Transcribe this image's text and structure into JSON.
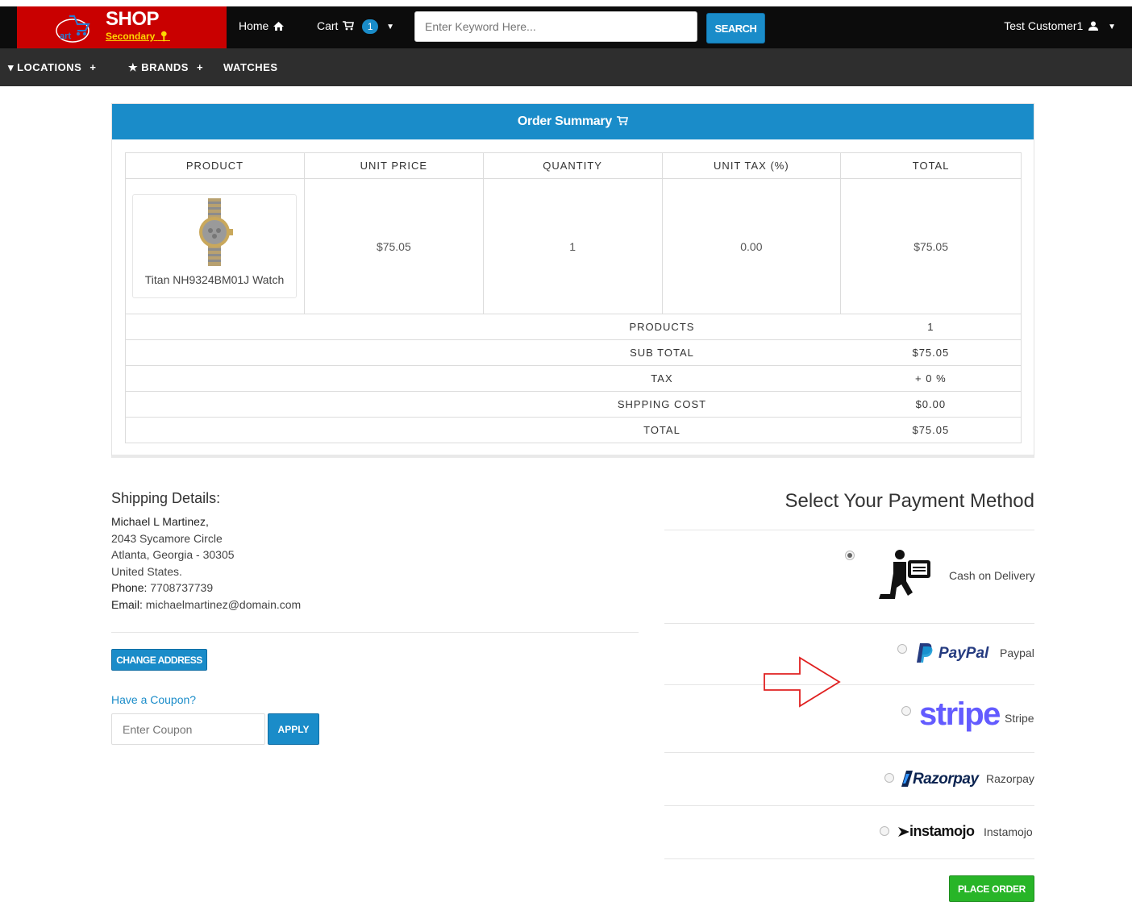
{
  "header": {
    "logo_title": "SHOP",
    "logo_subtitle": "Secondary",
    "home_label": "Home",
    "cart_label": "Cart",
    "cart_count": "1",
    "search_placeholder": "Enter Keyword Here...",
    "search_button": "SEARCH",
    "user_name": "Test Customer1"
  },
  "subnav": {
    "locations": "LOCATIONS",
    "brands": "BRANDS",
    "watches": "WATCHES"
  },
  "order_summary": {
    "title": "Order Summary",
    "columns": [
      "PRODUCT",
      "UNIT PRICE",
      "QUANTITY",
      "UNIT TAX (%)",
      "TOTAL"
    ],
    "product": {
      "name": "Titan NH9324BM01J Watch",
      "unit_price": "$75.05",
      "quantity": "1",
      "unit_tax": "0.00",
      "total": "$75.05"
    },
    "summary_rows": [
      {
        "label": "PRODUCTS",
        "value": "1"
      },
      {
        "label": "SUB TOTAL",
        "value": "$75.05"
      },
      {
        "label": "TAX",
        "value": "+ 0 %"
      },
      {
        "label": "SHPPING COST",
        "value": "$0.00"
      },
      {
        "label": "TOTAL",
        "value": "$75.05"
      }
    ]
  },
  "shipping": {
    "title": "Shipping Details:",
    "name": "Michael L Martinez,",
    "street": "2043 Sycamore Circle",
    "city": "Atlanta, Georgia - 30305",
    "country": "United States.",
    "phone_label": "Phone:",
    "phone": "7708737739",
    "email_label": "Email:",
    "email": "michaelmartinez@domain.com",
    "change_address": "CHANGE ADDRESS",
    "coupon_link": "Have a Coupon?",
    "coupon_placeholder": "Enter Coupon",
    "apply": "APPLY"
  },
  "payment": {
    "title": "Select Your Payment Method",
    "methods": [
      {
        "label": "Cash on Delivery",
        "selected": true
      },
      {
        "label": "Paypal",
        "logo": "PayPal",
        "selected": false
      },
      {
        "label": "Stripe",
        "logo": "stripe",
        "selected": false
      },
      {
        "label": "Razorpay",
        "logo": "Razorpay",
        "selected": false
      },
      {
        "label": "Instamojo",
        "logo": "instamojo",
        "selected": false
      }
    ],
    "place_order": "PLACE ORDER"
  },
  "colors": {
    "primary": "#1a8cc9",
    "logo_bg": "#c90000",
    "place_order": "#28b528",
    "annotation_arrow": "#e02020"
  }
}
